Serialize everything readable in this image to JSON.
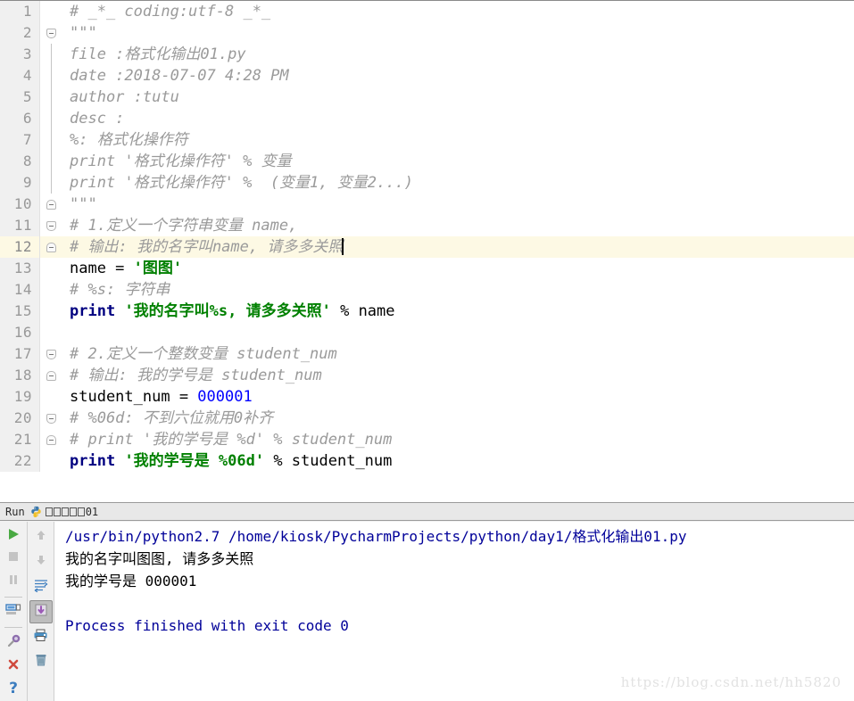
{
  "editor": {
    "current_line": 12,
    "lines": [
      {
        "n": 1,
        "fold": "none",
        "tokens": [
          {
            "t": "comment",
            "s": "# _*_ coding:utf-8 _*_"
          }
        ]
      },
      {
        "n": 2,
        "fold": "top",
        "tokens": [
          {
            "t": "comment",
            "s": "\"\"\""
          }
        ]
      },
      {
        "n": 3,
        "fold": "line",
        "tokens": [
          {
            "t": "comment",
            "s": "file :格式化输出01.py"
          }
        ]
      },
      {
        "n": 4,
        "fold": "line",
        "tokens": [
          {
            "t": "comment",
            "s": "date :2018-07-07 4:28 PM"
          }
        ]
      },
      {
        "n": 5,
        "fold": "line",
        "tokens": [
          {
            "t": "comment",
            "s": "author :tutu"
          }
        ]
      },
      {
        "n": 6,
        "fold": "line",
        "tokens": [
          {
            "t": "comment",
            "s": "desc :"
          }
        ]
      },
      {
        "n": 7,
        "fold": "line",
        "tokens": [
          {
            "t": "comment",
            "s": "%: 格式化操作符"
          }
        ]
      },
      {
        "n": 8,
        "fold": "line",
        "tokens": [
          {
            "t": "comment",
            "s": "print '格式化操作符' % 变量"
          }
        ]
      },
      {
        "n": 9,
        "fold": "line",
        "tokens": [
          {
            "t": "comment",
            "s": "print '格式化操作符' %  (变量1, 变量2...)"
          }
        ]
      },
      {
        "n": 10,
        "fold": "bottom",
        "tokens": [
          {
            "t": "comment",
            "s": "\"\"\""
          }
        ]
      },
      {
        "n": 11,
        "fold": "top",
        "tokens": [
          {
            "t": "comment",
            "s": "# 1.定义一个字符串变量 name,"
          }
        ]
      },
      {
        "n": 12,
        "fold": "bottom",
        "tokens": [
          {
            "t": "comment",
            "s": "# 输出: 我的名字叫name, 请多多关照"
          },
          {
            "t": "caret",
            "s": ""
          }
        ]
      },
      {
        "n": 13,
        "fold": "none",
        "tokens": [
          {
            "t": "plain",
            "s": "name = "
          },
          {
            "t": "str",
            "s": "'图图'"
          }
        ]
      },
      {
        "n": 14,
        "fold": "none",
        "tokens": [
          {
            "t": "comment",
            "s": "# %s: 字符串"
          }
        ]
      },
      {
        "n": 15,
        "fold": "none",
        "tokens": [
          {
            "t": "kw",
            "s": "print"
          },
          {
            "t": "plain",
            "s": " "
          },
          {
            "t": "str",
            "s": "'我的名字叫%s, 请多多关照'"
          },
          {
            "t": "plain",
            "s": " % name"
          }
        ]
      },
      {
        "n": 16,
        "fold": "none",
        "tokens": []
      },
      {
        "n": 17,
        "fold": "top",
        "tokens": [
          {
            "t": "comment",
            "s": "# 2.定义一个整数变量 student_num"
          }
        ]
      },
      {
        "n": 18,
        "fold": "bottom",
        "tokens": [
          {
            "t": "comment",
            "s": "# 输出: 我的学号是 student_num"
          }
        ]
      },
      {
        "n": 19,
        "fold": "none",
        "tokens": [
          {
            "t": "plain",
            "s": "student_num = "
          },
          {
            "t": "num",
            "s": "000001"
          }
        ]
      },
      {
        "n": 20,
        "fold": "top",
        "tokens": [
          {
            "t": "comment",
            "s": "# %06d: 不到六位就用0补齐"
          }
        ]
      },
      {
        "n": 21,
        "fold": "bottom",
        "tokens": [
          {
            "t": "comment",
            "s": "# print '我的学号是 %d' % student_num"
          }
        ]
      },
      {
        "n": 22,
        "fold": "none",
        "tokens": [
          {
            "t": "kw",
            "s": "print"
          },
          {
            "t": "plain",
            "s": " "
          },
          {
            "t": "str",
            "s": "'我的学号是 %06d'"
          },
          {
            "t": "plain",
            "s": " % student_num"
          }
        ]
      }
    ]
  },
  "run_window": {
    "tabbar": {
      "label": "Run",
      "icon": "python-icon",
      "tab_boxes": 5,
      "tab_suffix": "01"
    },
    "toolbar_left": [
      {
        "name": "rerun-button",
        "icon": "play-icon",
        "state": "enabled"
      },
      {
        "name": "stop-button",
        "icon": "stop-icon",
        "state": "disabled"
      },
      {
        "name": "pause-button",
        "icon": "pause-icon",
        "state": "disabled"
      },
      {
        "name": "show-console-button",
        "icon": "console-icon",
        "state": "enabled"
      },
      {
        "name": "pin-tab-button",
        "icon": "pin-icon",
        "state": "enabled"
      },
      {
        "name": "close-button",
        "icon": "close-icon",
        "state": "enabled"
      },
      {
        "name": "help-button",
        "icon": "help-icon",
        "state": "enabled"
      }
    ],
    "toolbar_right": [
      {
        "name": "up-button",
        "icon": "arrow-up-icon",
        "state": "disabled"
      },
      {
        "name": "down-button",
        "icon": "arrow-down-icon",
        "state": "disabled"
      },
      {
        "name": "soft-wrap-button",
        "icon": "soft-wrap-icon",
        "state": "enabled"
      },
      {
        "name": "scroll-to-end-button",
        "icon": "scroll-to-end-icon",
        "state": "pressed"
      },
      {
        "name": "print-button",
        "icon": "print-icon",
        "state": "enabled"
      },
      {
        "name": "clear-all-button",
        "icon": "trash-icon",
        "state": "enabled"
      }
    ],
    "console": [
      {
        "color": "blue",
        "text": "/usr/bin/python2.7 /home/kiosk/PycharmProjects/python/day1/格式化输出01.py"
      },
      {
        "color": "black",
        "text": "我的名字叫图图, 请多多关照"
      },
      {
        "color": "black",
        "text": "我的学号是 000001"
      },
      {
        "color": "black",
        "text": ""
      },
      {
        "color": "blue",
        "text": "Process finished with exit code 0"
      }
    ]
  },
  "watermark": {
    "text": "https://blog.csdn.net/hh5820"
  },
  "colors": {
    "comment": "#9a9a9a",
    "keyword": "#000080",
    "string": "#008000",
    "number": "#0000ff",
    "console_blue": "#000099",
    "current_line_bg": "#fdf9e4",
    "gutter_bg": "#f0f0f0"
  }
}
